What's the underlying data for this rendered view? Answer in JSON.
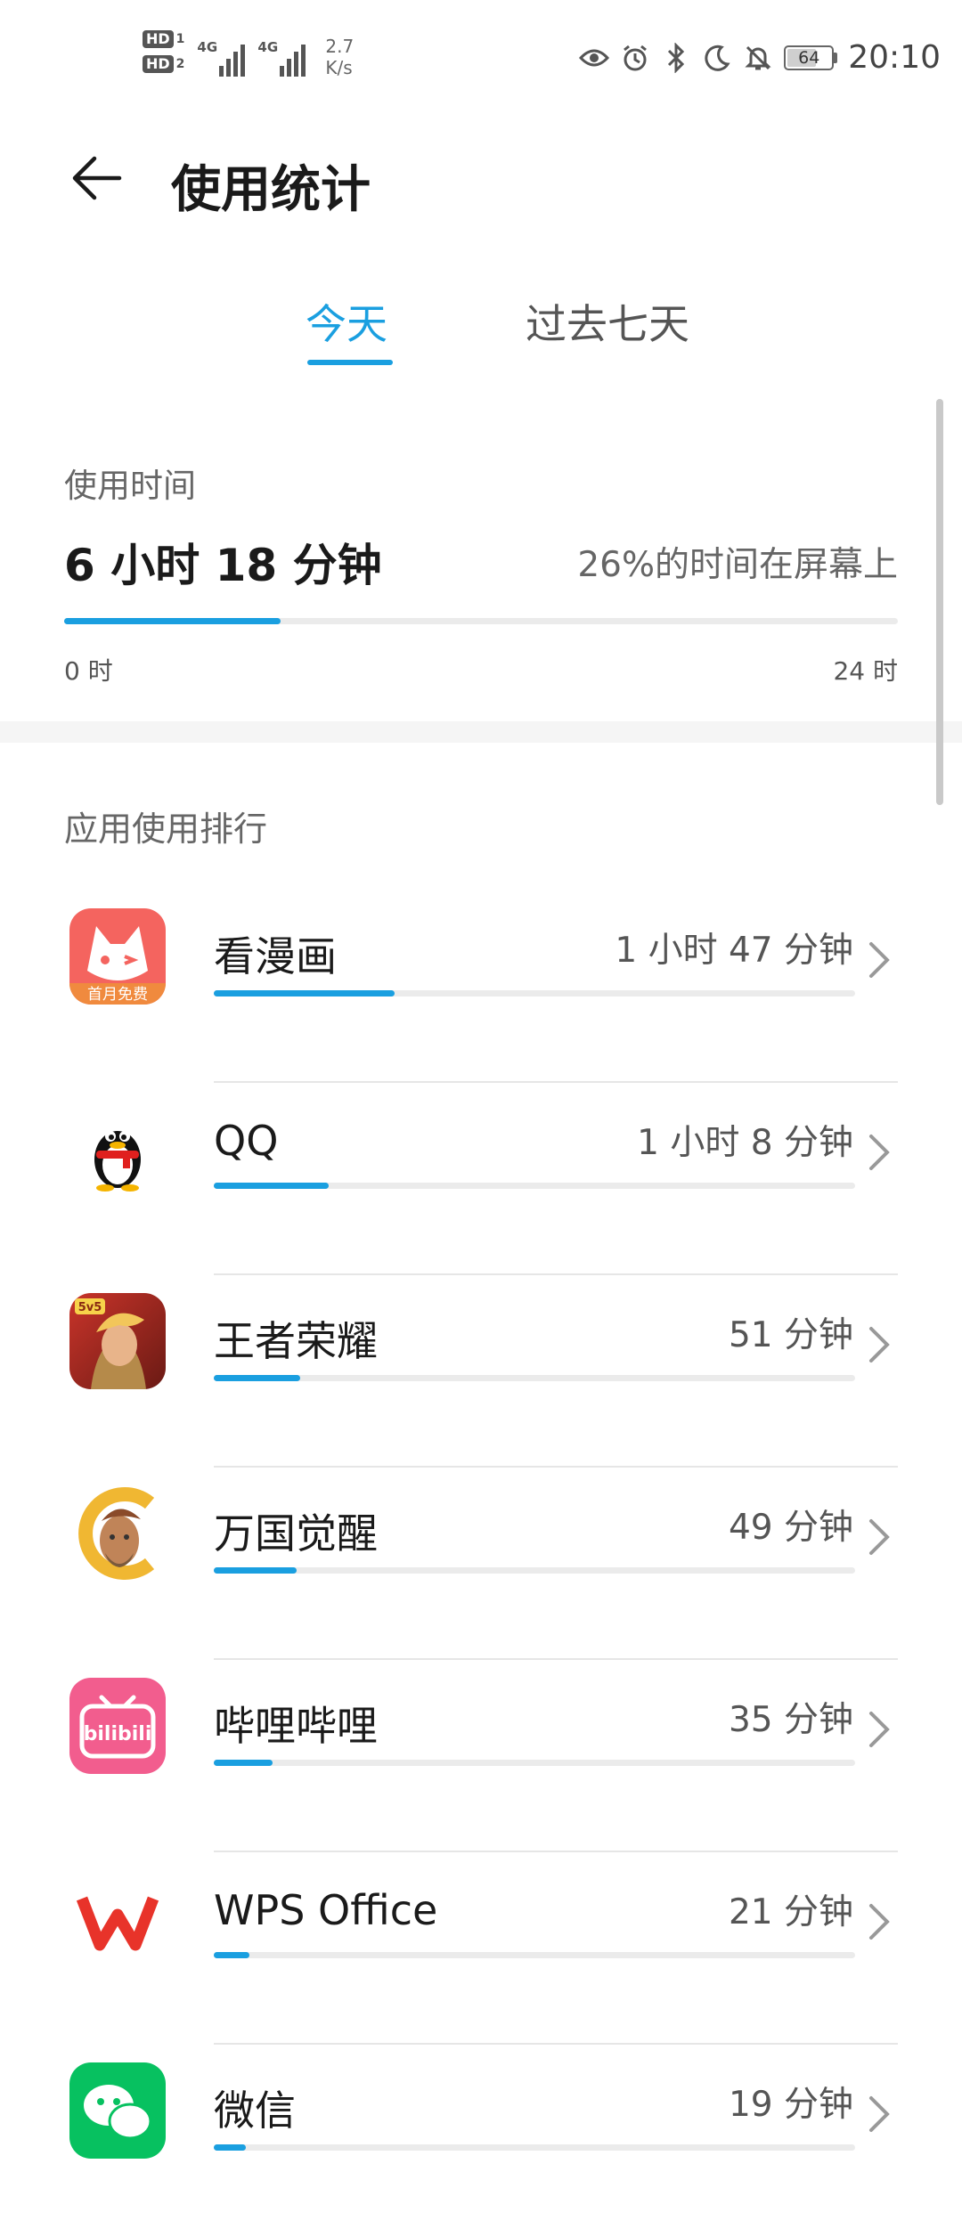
{
  "status_bar": {
    "hd1": "HD",
    "hd1_sub": "1",
    "hd2": "HD",
    "hd2_sub": "2",
    "net1": "4G",
    "net2": "4G",
    "speed_value": "2.7",
    "speed_unit": "K/s",
    "battery": "64",
    "time": "20:10",
    "icons": [
      "eye-icon",
      "alarm-icon",
      "bluetooth-icon",
      "moon-icon",
      "bell-off-icon"
    ]
  },
  "header": {
    "title": "使用统计"
  },
  "tabs": [
    {
      "label": "今天",
      "active": true
    },
    {
      "label": "过去七天",
      "active": false
    }
  ],
  "summary": {
    "label": "使用时间",
    "total": "6 小时 18 分钟",
    "screen_percent_text": "26%的时间在屏幕上",
    "progress_fraction": 0.26,
    "axis_start": "0 时",
    "axis_end": "24 时"
  },
  "ranking": {
    "title": "应用使用排行",
    "apps": [
      {
        "name": "看漫画",
        "time": "1 小时 47 分钟",
        "minutes": 107,
        "icon": "kanmanhua-icon"
      },
      {
        "name": "QQ",
        "time": "1 小时 8 分钟",
        "minutes": 68,
        "icon": "qq-icon"
      },
      {
        "name": "王者荣耀",
        "time": "51 分钟",
        "minutes": 51,
        "icon": "honor-of-kings-icon"
      },
      {
        "name": "万国觉醒",
        "time": "49 分钟",
        "minutes": 49,
        "icon": "rise-of-kingdoms-icon"
      },
      {
        "name": "哔哩哔哩",
        "time": "35 分钟",
        "minutes": 35,
        "icon": "bilibili-icon"
      },
      {
        "name": "WPS Office",
        "time": "21 分钟",
        "minutes": 21,
        "icon": "wps-icon"
      },
      {
        "name": "微信",
        "time": "19 分钟",
        "minutes": 19,
        "icon": "wechat-icon"
      }
    ],
    "scale_max_minutes": 380
  },
  "icon_texts": {
    "kanmanhua_badge": "首月免费",
    "bilibili_logo": "bilibili",
    "honor_badge": "5v5"
  },
  "colors": {
    "accent": "#1a9fe0",
    "kanmanhua": "#f4645f",
    "bilibili": "#f25d8e",
    "wps": "#e8332a",
    "wechat": "#07c160"
  }
}
